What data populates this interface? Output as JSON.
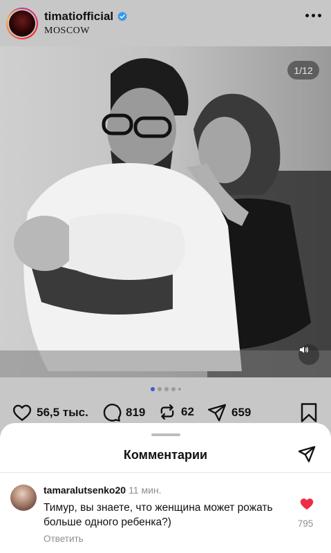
{
  "post": {
    "username": "timatiofficial",
    "location": "MOSCOW",
    "image_counter": "1/12",
    "carousel": {
      "total_dots_visible": 5,
      "active_index": 0
    }
  },
  "actions": {
    "likes": "56,5 тыс.",
    "comments": "819",
    "reposts": "62",
    "shares": "659"
  },
  "comments_sheet": {
    "title": "Комментарии",
    "comment": {
      "username": "tamaralutsenko20",
      "time": "11 мин.",
      "text": "Тимур, вы знаете, что женщина может рожать больше одного ребенка?)",
      "reply_label": "Ответить",
      "like_count": "795",
      "liked": true
    }
  },
  "colors": {
    "accent_blue": "#3b5ad8",
    "like_red": "#ed2c45",
    "verified_blue": "#3897f0"
  },
  "icons": [
    "more-icon",
    "verified-icon",
    "heart-icon",
    "comment-icon",
    "repost-icon",
    "send-icon",
    "bookmark-icon",
    "mute-icon"
  ]
}
